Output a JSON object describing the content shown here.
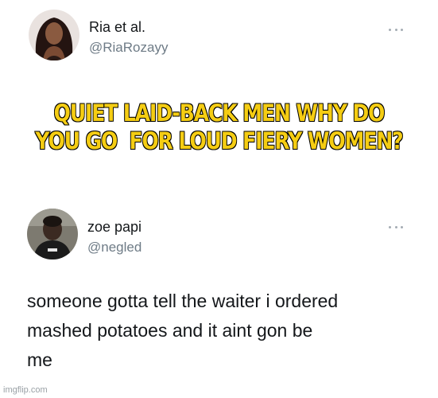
{
  "tweets": [
    {
      "display_name": "Ria et al.",
      "handle": "@RiaRozayy",
      "avatar_icon": "profile-photo-woman",
      "more_icon": "more-horizontal-icon",
      "caption": "QUIET LAID-BACK MEN WHY DO\nYOU GO  FOR LOUD FIERY WOMEN?"
    },
    {
      "display_name": "zoe papi",
      "handle": "@negled",
      "avatar_icon": "profile-photo-man",
      "more_icon": "more-horizontal-icon",
      "text": "someone gotta tell the waiter i ordered\nmashed potatoes and it aint gon be\nme"
    }
  ],
  "watermark": "imgflip.com",
  "colors": {
    "caption_fill": "#f5cd13",
    "caption_outline": "#1a1500",
    "handle": "#6e7b86",
    "text": "#14171a"
  }
}
